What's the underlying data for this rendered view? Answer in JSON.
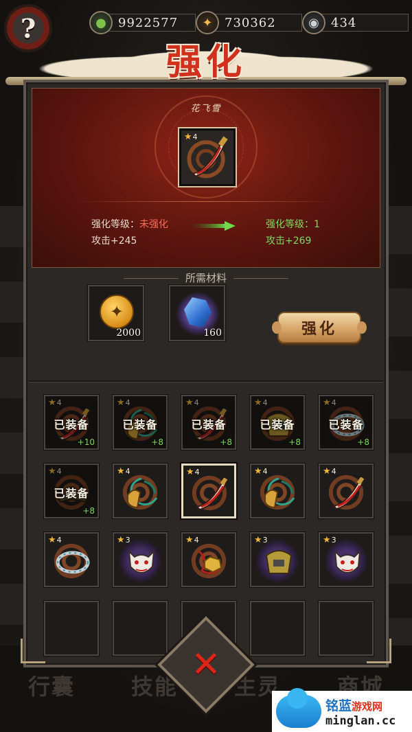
{
  "currencies": [
    {
      "icon": "jade-icon",
      "value": "9922577"
    },
    {
      "icon": "coin-icon",
      "value": "730362"
    },
    {
      "icon": "swirl-icon",
      "value": "434"
    }
  ],
  "help_label": "?",
  "title": "强化",
  "hero": {
    "item_name": "花飞雪",
    "item_stars": "4",
    "current": {
      "level_label": "强化等级：",
      "level_value": "未强化",
      "attack": "攻击+245"
    },
    "next": {
      "level_label": "强化等级：",
      "level_value": "1",
      "attack": "攻击+269"
    }
  },
  "materials": {
    "title": "所需材料",
    "items": [
      {
        "icon": "coin-icon",
        "amount": "2000"
      },
      {
        "icon": "blue-gem-icon",
        "amount": "160"
      }
    ]
  },
  "enhance_button": "强化",
  "equipment": [
    {
      "stars": "4",
      "equipped": "已装备",
      "plus": "+10",
      "icon": "sword-icon"
    },
    {
      "stars": "4",
      "equipped": "已装备",
      "plus": "+8",
      "icon": "jade-pendant-icon"
    },
    {
      "stars": "4",
      "equipped": "已装备",
      "plus": "+8",
      "icon": "sword-icon"
    },
    {
      "stars": "4",
      "equipped": "已装备",
      "plus": "+8",
      "icon": "armor-icon"
    },
    {
      "stars": "4",
      "equipped": "已装备",
      "plus": "+8",
      "icon": "bracelet-icon"
    },
    {
      "stars": "4",
      "equipped": "已装备",
      "plus": "+8",
      "icon": "hat-icon"
    },
    {
      "stars": "4",
      "icon": "jade-pendant-icon"
    },
    {
      "stars": "4",
      "icon": "sword-icon",
      "selected": true
    },
    {
      "stars": "4",
      "icon": "jade-pendant-icon"
    },
    {
      "stars": "4",
      "icon": "sword-icon"
    },
    {
      "stars": "4",
      "icon": "bracelet-icon"
    },
    {
      "stars": "3",
      "icon": "oni-mask-icon"
    },
    {
      "stars": "4",
      "icon": "gold-amulet-icon"
    },
    {
      "stars": "3",
      "icon": "armor-icon"
    },
    {
      "stars": "3",
      "icon": "oni-mask-icon"
    }
  ],
  "close_label": "✕",
  "bottom_tabs": [
    "行囊",
    "技能",
    "生灵",
    "商城"
  ],
  "watermark": {
    "brand": "铭蓝",
    "brand_suffix": "游戏网",
    "url": "minglan.cc"
  },
  "colors": {
    "accent_red": "#d0301c",
    "stat_green": "#7ddc5a",
    "panel": "#2b2826"
  }
}
